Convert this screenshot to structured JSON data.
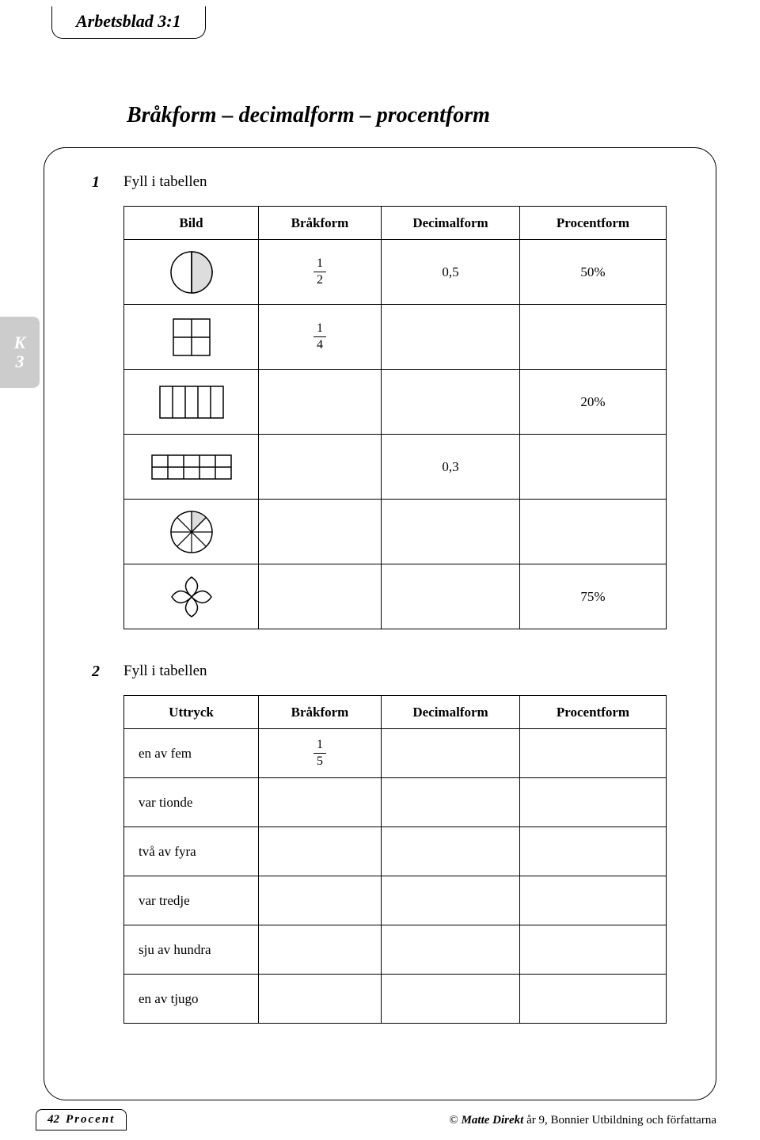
{
  "header_tab": "Arbetsblad 3:1",
  "main_title": "Bråkform – decimalform – procentform",
  "side_tab": {
    "line1": "K",
    "line2": "3"
  },
  "exercise1": {
    "num": "1",
    "instruction": "Fyll i tabellen",
    "headers": [
      "Bild",
      "Bråkform",
      "Decimalform",
      "Procentform"
    ],
    "rows": [
      {
        "frac_n": "1",
        "frac_d": "2",
        "dec": "0,5",
        "pct": "50%"
      },
      {
        "frac_n": "1",
        "frac_d": "4",
        "dec": "",
        "pct": ""
      },
      {
        "frac_n": "",
        "frac_d": "",
        "dec": "",
        "pct": "20%"
      },
      {
        "frac_n": "",
        "frac_d": "",
        "dec": "0,3",
        "pct": ""
      },
      {
        "frac_n": "",
        "frac_d": "",
        "dec": "",
        "pct": ""
      },
      {
        "frac_n": "",
        "frac_d": "",
        "dec": "",
        "pct": "75%"
      }
    ]
  },
  "exercise2": {
    "num": "2",
    "instruction": "Fyll i tabellen",
    "headers": [
      "Uttryck",
      "Bråkform",
      "Decimalform",
      "Procentform"
    ],
    "rows": [
      {
        "uttryck": "en av fem",
        "frac_n": "1",
        "frac_d": "5"
      },
      {
        "uttryck": "var tionde",
        "frac_n": "",
        "frac_d": ""
      },
      {
        "uttryck": "två av fyra",
        "frac_n": "",
        "frac_d": ""
      },
      {
        "uttryck": "var tredje",
        "frac_n": "",
        "frac_d": ""
      },
      {
        "uttryck": "sju av hundra",
        "frac_n": "",
        "frac_d": ""
      },
      {
        "uttryck": "en av tjugo",
        "frac_n": "",
        "frac_d": ""
      }
    ]
  },
  "footer": {
    "page": "42",
    "section": "Procent",
    "copyright_pre": "© ",
    "copyright_title": "Matte Direkt",
    "copyright_post": " år 9, Bonnier Utbildning och författarna"
  }
}
